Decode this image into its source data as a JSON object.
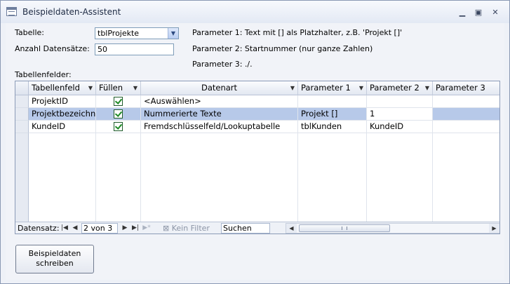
{
  "window": {
    "title": "Beispieldaten-Assistent",
    "minimize": "▁",
    "restore": "▣",
    "close": "✕"
  },
  "form": {
    "tabelle_label": "Tabelle:",
    "tabelle_value": "tblProjekte",
    "anzahl_label": "Anzahl Datensätze:",
    "anzahl_value": "50",
    "param1_info": "Parameter 1: Text mit [] als Platzhalter, z.B. 'Projekt []'",
    "param2_info": "Parameter 2: Startnummer (nur ganze Zahlen)",
    "param3_info": "Parameter 3: ./.",
    "fields_label": "Tabellenfelder:"
  },
  "grid": {
    "columns": [
      "Tabellenfeld",
      "Füllen",
      "Datenart",
      "Parameter 1",
      "Parameter 2",
      "Parameter 3"
    ],
    "rows": [
      {
        "feld": "ProjektID",
        "fuellen": true,
        "datenart": "<Auswählen>",
        "p1": "",
        "p2": "",
        "p3": ""
      },
      {
        "feld": "Projektbezeichnung",
        "fuellen": true,
        "datenart": "Nummerierte Texte",
        "p1": "Projekt []",
        "p2": "1",
        "p3": ""
      },
      {
        "feld": "KundeID",
        "fuellen": true,
        "datenart": "Fremdschlüsselfeld/Lookuptabelle",
        "p1": "tblKunden",
        "p2": "KundeID",
        "p3": ""
      }
    ]
  },
  "navbar": {
    "label": "Datensatz:",
    "position": "2 von 3",
    "filter": "Kein Filter",
    "search": "Suchen"
  },
  "action": {
    "line1": "Beispieldaten",
    "line2": "schreiben"
  }
}
